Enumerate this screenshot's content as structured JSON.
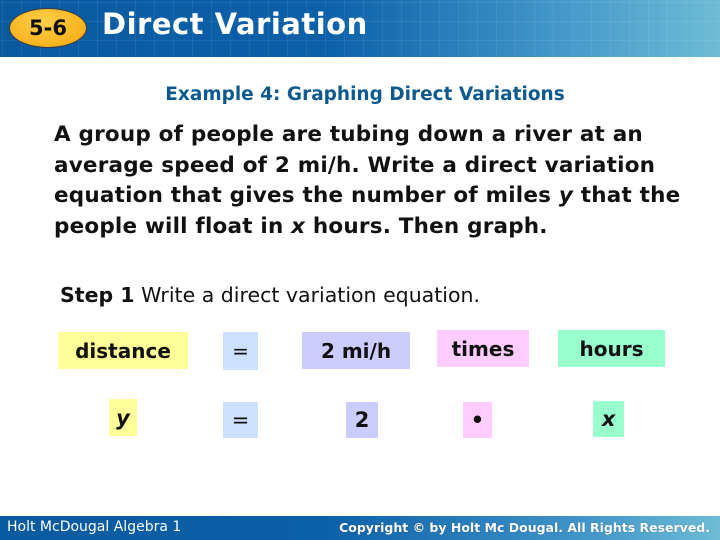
{
  "header": {
    "lesson_number": "5-6",
    "title": "Direct Variation"
  },
  "example": {
    "title": "Example 4: Graphing Direct Variations"
  },
  "problem": {
    "part1": "A group of people are tubing down a river at an average speed of 2 mi/h. Write a direct variation equation that gives the number of miles ",
    "var_y": "y",
    "part2": " that the people will float in ",
    "var_x": "x",
    "part3": " hours. Then graph."
  },
  "step1": {
    "label": "Step 1",
    "text": " Write a direct variation equation."
  },
  "equation": {
    "words": [
      {
        "text": "distance",
        "color": "#ffff99"
      },
      {
        "text": "=",
        "color": "#cce0ff"
      },
      {
        "text": "2 mi/h",
        "color": "#ccccff"
      },
      {
        "text": "times",
        "color": "#ffccff"
      },
      {
        "text": "hours",
        "color": "#99ffcc"
      }
    ],
    "symbols": [
      {
        "text": "y",
        "color": "#ffff99"
      },
      {
        "text": "=",
        "color": "#cce0ff"
      },
      {
        "text": "2",
        "color": "#ccccff"
      },
      {
        "text": "•",
        "color": "#ffccff"
      },
      {
        "text": "x",
        "color": "#99ffcc"
      }
    ]
  },
  "footer": {
    "publisher": "Holt McDougal Algebra 1",
    "copyright": "Copyright © by Holt Mc Dougal. All Rights Reserved."
  }
}
